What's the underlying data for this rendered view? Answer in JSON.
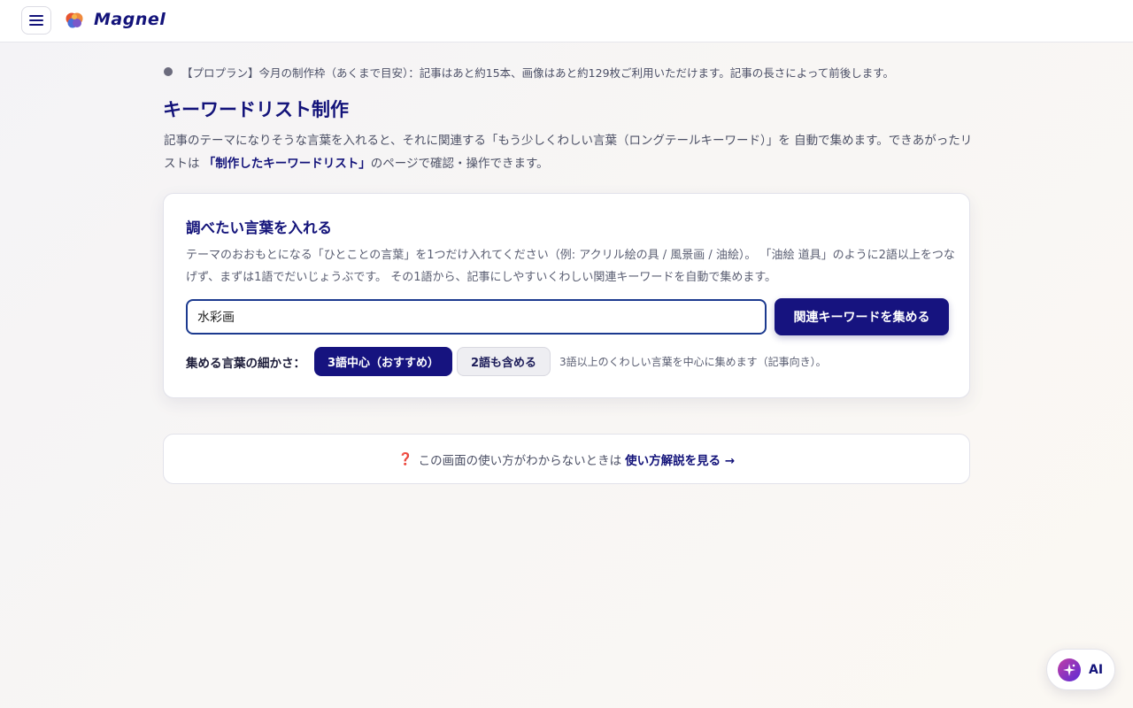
{
  "header": {
    "app_name": "Magnel"
  },
  "notice": {
    "text": "【プロプラン】今月の制作枠（あくまで目安）：記事はあと約15本、画像はあと約129枚ご利用いただけます。記事の長さによって前後します。"
  },
  "page": {
    "title": "キーワードリスト制作",
    "desc_part1": "記事のテーマになりそうな言葉を入れると、それに関連する「もう少しくわしい言葉（ロングテールキーワード）」を 自動で集めます。できあがったリストは ",
    "desc_link": "「制作したキーワードリスト」",
    "desc_part2": "のページで確認・操作できます。"
  },
  "card": {
    "title": "調べたい言葉を入れる",
    "desc": "テーマのおおもとになる「ひとことの言葉」を1つだけ入れてください（例: アクリル絵の具 / 風景画 / 油絵）。 「油絵 道具」のように2語以上をつなげず、まずは1語でだいじょうぶです。 その1語から、記事にしやすいくわしい関連キーワードを自動で集めます。",
    "input_value": "水彩画",
    "collect_label": "関連キーワードを集める",
    "granularity_label": "集める言葉の細かさ：",
    "options": [
      {
        "label": "3語中心（おすすめ）",
        "selected": true
      },
      {
        "label": "2語も含める",
        "selected": false
      }
    ],
    "option_help": "3語以上のくわしい言葉を中心に集めます（記事向き）。"
  },
  "help": {
    "text": "この画面の使い方がわからないときは",
    "link": "使い方解説を見る →"
  },
  "ai_button": {
    "label": "AI"
  },
  "colors": {
    "brand": "#13137a",
    "primary_button": "#16137f",
    "input_border": "#1c3a8f"
  }
}
